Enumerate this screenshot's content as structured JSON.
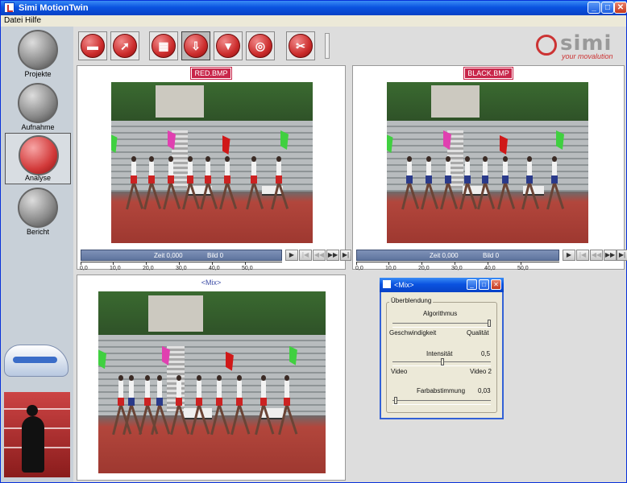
{
  "window": {
    "title": "Simi MotionTwin"
  },
  "menu": {
    "file": "Datei",
    "help": "Hilfe"
  },
  "sidebar": {
    "items": [
      {
        "label": "Projekte"
      },
      {
        "label": "Aufnahme"
      },
      {
        "label": "Analyse"
      },
      {
        "label": "Bericht"
      }
    ]
  },
  "logo": {
    "word": "simi",
    "tagline": "your movalution"
  },
  "panes": {
    "left": {
      "title": "RED.BMP"
    },
    "right": {
      "title": "BLACK.BMP"
    },
    "mix": {
      "title": "<Mix>"
    }
  },
  "playbar": {
    "zeit": "Zeit 0,000",
    "bild": "Bild 0",
    "ticks": [
      "0,0",
      "10,0",
      "20,0",
      "30,0",
      "40,0",
      "50,0"
    ]
  },
  "mix_dialog": {
    "title": "<Mix>",
    "group_label": "Überblendung",
    "algorithm_label": "Algorithmus",
    "speed_label": "Geschwindigkeit",
    "quality_label": "Qualität",
    "intensity_label": "Intensität",
    "intensity_value": "0,5",
    "video_label": "Video",
    "video2_label": "Video 2",
    "color_label": "Farbabstimmung",
    "color_value": "0,03"
  }
}
